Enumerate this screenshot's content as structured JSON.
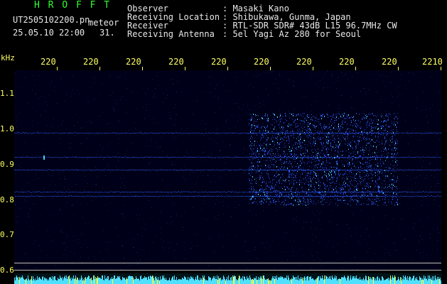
{
  "header": {
    "title": "H R O F F T",
    "filename": "UT2505102200.pn",
    "meteor_label": "meteor",
    "datetime": "25.05.10 22:00",
    "count": "31."
  },
  "meta": {
    "observer_label": "Observer",
    "observer_value": ": Masaki Kano",
    "location_label": "Receiving Location",
    "location_value": ": Shibukawa, Gunma, Japan",
    "receiver_label": "Receiver",
    "receiver_value": ": RTL-SDR SDR# 43dB L15 96.7MHz CW",
    "antenna_label": "Receiving Antenna",
    "antenna_value": ": 5el Yagi Az 280 for Seoul"
  },
  "axis": {
    "y_unit": "kHz",
    "x_ticks": [
      "220",
      "220",
      "220",
      "220",
      "220",
      "220",
      "220",
      "220",
      "220",
      "2210"
    ],
    "y_ticks": [
      "1.1",
      "1.0",
      "0.9",
      "0.8",
      "0.7",
      "0.6"
    ]
  },
  "colors": {
    "background": "#000000",
    "plot_bg": "#000018",
    "header_green": "#33ff33",
    "label_yellow": "#ffff66",
    "text_white": "#e8e8e8",
    "signal_blue": "#2f5bff",
    "signal_cyan": "#4fe0ff",
    "bar_cyan": "#4fe0ff",
    "bar_yellow": "#ffff33"
  }
}
